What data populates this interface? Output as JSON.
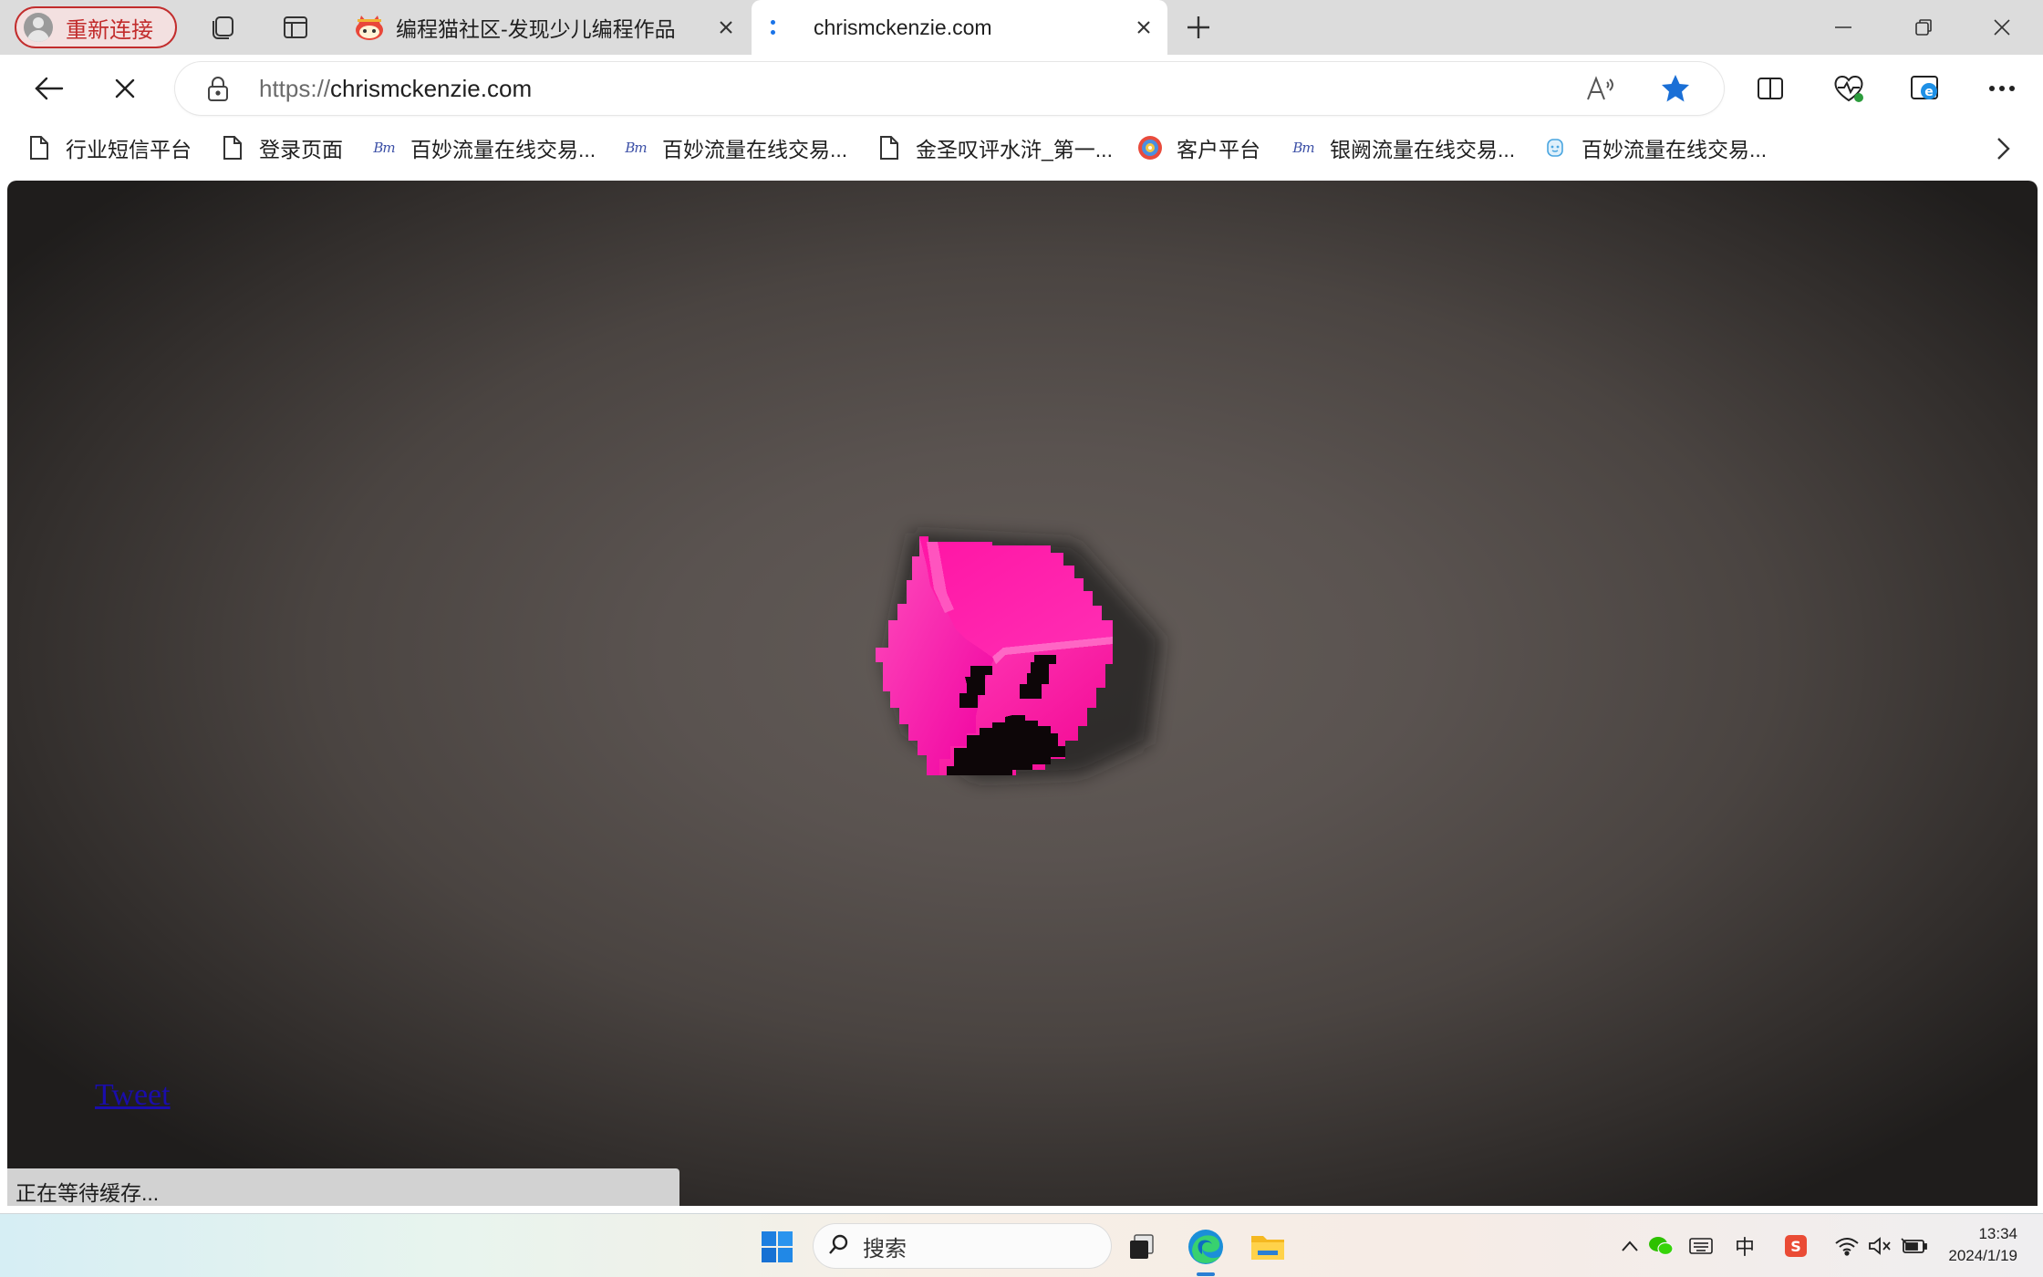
{
  "browser": {
    "profile_label": "重新连接",
    "tabs": [
      {
        "title": "编程猫社区-发现少儿编程作品",
        "active": false
      },
      {
        "title": "chrismckenzie.com",
        "active": true
      }
    ],
    "address": {
      "scheme": "https://",
      "host": "chrismckenzie.com"
    },
    "bookmarks": [
      {
        "label": "行业短信平台",
        "icon": "page-icon"
      },
      {
        "label": "登录页面",
        "icon": "page-icon"
      },
      {
        "label": "百妙流量在线交易...",
        "icon": "script-logo-icon"
      },
      {
        "label": "百妙流量在线交易...",
        "icon": "script-logo-icon"
      },
      {
        "label": "金圣叹评水浒_第一...",
        "icon": "page-icon"
      },
      {
        "label": "客户平台",
        "icon": "colorful-circle-icon"
      },
      {
        "label": "银阙流量在线交易...",
        "icon": "script-logo-icon"
      },
      {
        "label": "百妙流量在线交易...",
        "icon": "blue-face-icon"
      }
    ],
    "status_text": "正在等待缓存..."
  },
  "page": {
    "tweet_link": "Tweet",
    "cube_color": "#ff1aa8"
  },
  "taskbar": {
    "search_label": "搜索",
    "ime_label": "中",
    "time": "13:34",
    "date": "2024/1/19"
  },
  "colors": {
    "profile_accent": "#c22d2d",
    "favorite_star": "#1a6fd6",
    "link": "#1a0dab"
  }
}
